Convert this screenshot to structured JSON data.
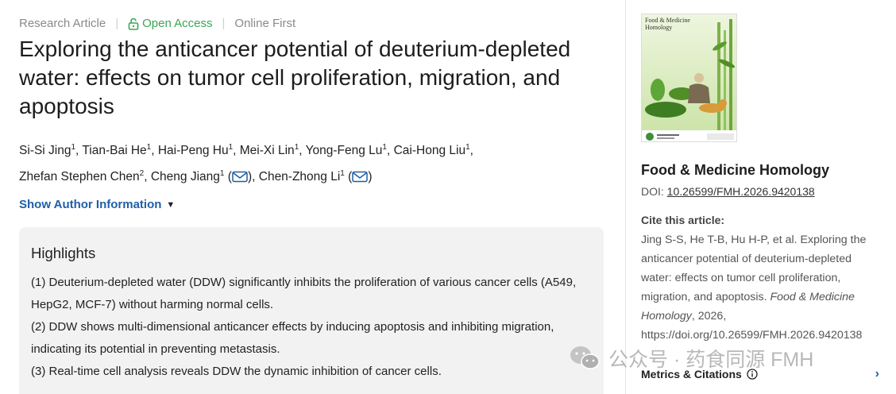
{
  "meta": {
    "article_type": "Research Article",
    "access": "Open Access",
    "status": "Online First"
  },
  "title": "Exploring the anticancer potential of deuterium-depleted water: effects on tumor cell proliferation, migration, and apoptosis",
  "authors": [
    {
      "name": "Si-Si Jing",
      "sup": "1",
      "sep": ", "
    },
    {
      "name": "Tian-Bai He",
      "sup": "1",
      "sep": ", "
    },
    {
      "name": "Hai-Peng Hu",
      "sup": "1",
      "sep": ", "
    },
    {
      "name": "Mei-Xi Lin",
      "sup": "1",
      "sep": ", "
    },
    {
      "name": "Yong-Feng Lu",
      "sup": "1",
      "sep": ", "
    },
    {
      "name": "Cai-Hong Liu",
      "sup": "1",
      "sep": ","
    },
    {
      "name": "Zhefan Stephen Chen",
      "sup": "2",
      "sep": ", "
    },
    {
      "name": "Cheng Jiang",
      "sup": "1",
      "sep": ", "
    },
    {
      "name": "Chen-Zhong Li",
      "sup": "1",
      "sep": ""
    }
  ],
  "show_author_info": "Show Author Information",
  "highlights": {
    "heading": "Highlights",
    "items": [
      "(1) Deuterium-depleted water (DDW) significantly inhibits the proliferation of various cancer cells (A549, HepG2, MCF-7) without harming normal cells.",
      "(2) DDW shows multi-dimensional anticancer effects by inducing apoptosis and inhibiting migration, indicating its potential in preventing metastasis.",
      "(3) Real-time cell analysis reveals DDW the dynamic inhibition of cancer cells."
    ]
  },
  "sidebar": {
    "cover_title": "Food & Medicine Homology",
    "journal_name": "Food & Medicine Homology",
    "doi_label": "DOI: ",
    "doi_value": "10.26599/FMH.2026.9420138",
    "cite_label": "Cite this article:",
    "cite_text_plain": "Jing S-S, He T-B, Hu H-P, et al. Exploring the anticancer potential of deuterium-depleted water: effects on tumor cell proliferation, migration, and apoptosis. ",
    "cite_journal": "Food & Medicine Homology",
    "cite_tail": ", 2026, https://doi.org/10.26599/FMH.2026.9420138",
    "metrics_label": "Metrics & Citations"
  },
  "watermark": "公众号 · 药食同源 FMH",
  "colors": {
    "link_blue": "#1f5fa6",
    "open_access_green": "#3aa757",
    "highlight_bg": "#f2f2f2"
  },
  "icons": [
    "lock-open-icon",
    "mail-icon",
    "caret-down-icon",
    "info-icon",
    "chevron-right-icon",
    "wechat-icon"
  ]
}
